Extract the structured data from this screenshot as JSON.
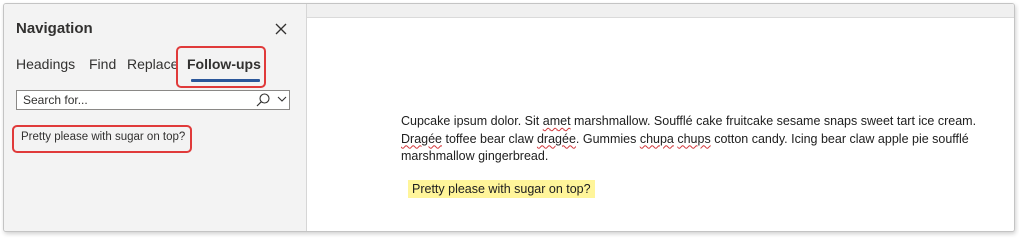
{
  "navigation": {
    "title": "Navigation",
    "tabs": [
      {
        "label": "Headings"
      },
      {
        "label": "Find"
      },
      {
        "label": "Replace"
      },
      {
        "label": "Follow-ups",
        "active": true
      }
    ],
    "search": {
      "placeholder": "Search for...",
      "value": ""
    },
    "results": [
      {
        "text": "Pretty please with sugar on top?"
      }
    ],
    "icons": {
      "close": "close-icon",
      "search": "search-icon",
      "dropdown": "chevron-down-icon"
    }
  },
  "document": {
    "paragraph": {
      "part1": "Cupcake ipsum dolor. Sit ",
      "spell1": "amet",
      "part2": " marshmallow. Soufflé cake fruitcake sesame snaps sweet tart ice cream. ",
      "spell2": "Dragée",
      "part3": " toffee bear claw ",
      "spell3": "dragée",
      "part4": ". Gummies ",
      "spell4": "chupa",
      "part5": " ",
      "spell5": "chups",
      "part6": " cotton candy. Icing bear claw apple pie soufflé marshmallow gingerbread."
    },
    "followup_text": "Pretty please with sugar on top?"
  },
  "colors": {
    "accent": "#2b579a",
    "callout": "#e03a3a",
    "highlight": "#fff59a",
    "pane_bg": "#f3f3f3"
  }
}
